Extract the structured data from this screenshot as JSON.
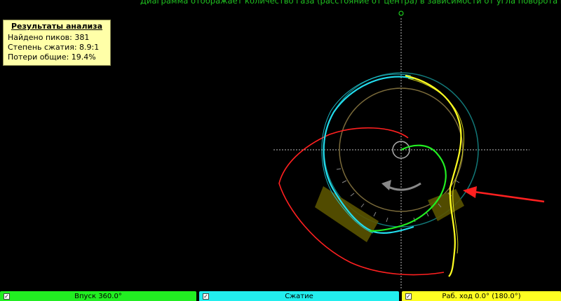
{
  "caption": "Диаграмма отображает количество газа (расстояние от центра) в зависимости от угла поворота коленвала",
  "results": {
    "title": "Результаты анализа",
    "peaks": "Найдено пиков: 381",
    "compression": "Степень сжатия: 8.9:1",
    "losses": "Потери общие: 19.4%"
  },
  "tabs": [
    {
      "label": "Впуск 360.0°",
      "color": "#22ee22",
      "checked": true
    },
    {
      "label": "Сжатие",
      "color": "#22eeee",
      "checked": true
    },
    {
      "label": "Раб. ход 0.0° (180.0°)",
      "color": "#ffff22",
      "checked": true
    }
  ],
  "colors": {
    "intake": "#ff2020",
    "compression": "#22ddee",
    "power": "#ffff22",
    "exhaust": "#22ee22",
    "crosshair": "#c8c8c8",
    "center_marker": "#22ee22",
    "arrow": "#ff2020"
  }
}
